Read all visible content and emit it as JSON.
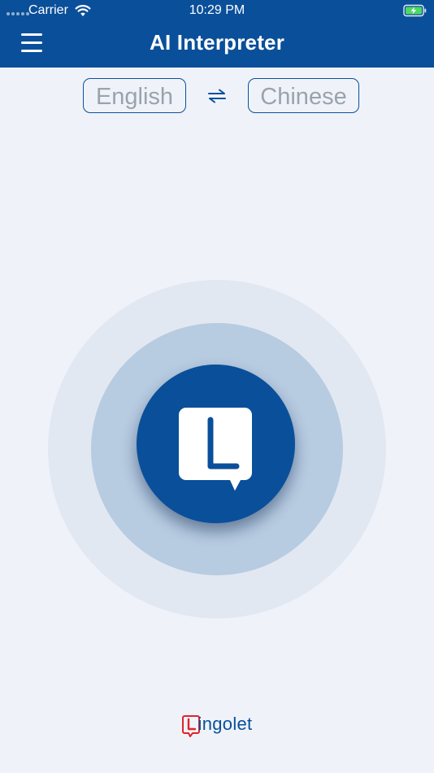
{
  "status_bar": {
    "carrier": "Carrier",
    "time": "10:29 PM",
    "wifi_icon": "wifi-icon",
    "battery_icon": "battery-charging-icon"
  },
  "nav": {
    "title": "AI Interpreter",
    "menu_icon": "hamburger-menu-icon"
  },
  "languages": {
    "source": "English",
    "target": "Chinese",
    "swap_icon": "swap-arrows-icon"
  },
  "talk": {
    "icon": "lingolet-speech-bubble-icon"
  },
  "footer": {
    "brand_suffix": "ingolet",
    "brand_icon": "lingolet-logo-icon"
  },
  "colors": {
    "primary": "#0a4f9a",
    "background": "#eff3f9",
    "pulse_outer": "#e1e8f2",
    "pulse_mid": "#b7cbe1",
    "lang_text": "#9aa3ad",
    "logo_red": "#e0232a",
    "battery_green": "#4cd964"
  }
}
